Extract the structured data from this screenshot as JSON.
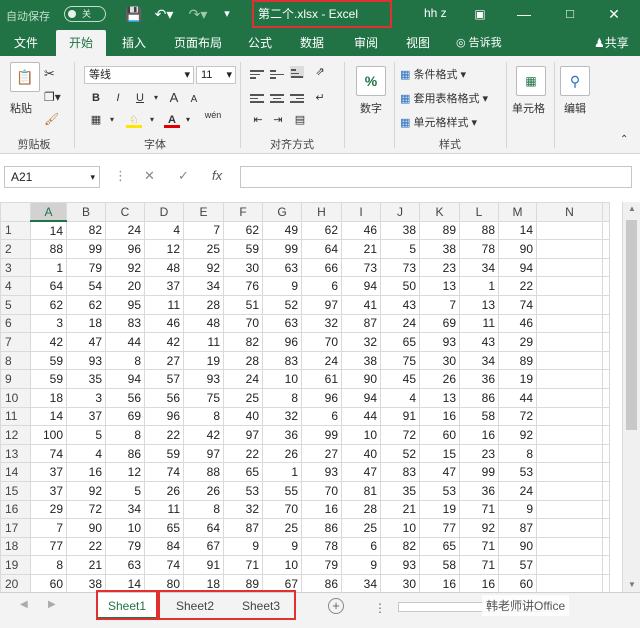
{
  "titlebar": {
    "autosave": "自动保存",
    "autosave_state": "关",
    "title": "第二个.xlsx  -  Excel",
    "user": "hh z"
  },
  "tabs": [
    "文件",
    "开始",
    "插入",
    "页面布局",
    "公式",
    "数据",
    "审阅",
    "视图"
  ],
  "active_tab": "开始",
  "tell_me": "告诉我",
  "share": "共享",
  "ribbon": {
    "clipboard": {
      "paste": "粘贴",
      "label": "剪贴板"
    },
    "font": {
      "name": "等线",
      "size": "11",
      "label": "字体",
      "bold": "B",
      "italic": "I",
      "underline": "U",
      "grow": "A",
      "shrink": "A",
      "wen": "wén"
    },
    "alignment": {
      "label": "对齐方式"
    },
    "number": {
      "label": "数字",
      "icon": "%"
    },
    "styles": {
      "conditional": "条件格式",
      "table": "套用表格格式",
      "cell": "单元格样式",
      "label": "样式"
    },
    "cells": {
      "label": "单元格"
    },
    "editing": {
      "label": "编辑"
    }
  },
  "formula_bar": {
    "name_box": "A21",
    "fx": "fx"
  },
  "columns": [
    "A",
    "B",
    "C",
    "D",
    "E",
    "F",
    "G",
    "H",
    "I",
    "J",
    "K",
    "L",
    "M",
    "N"
  ],
  "rows": [
    [
      14,
      82,
      24,
      4,
      7,
      62,
      49,
      62,
      46,
      38,
      89,
      88,
      14
    ],
    [
      88,
      99,
      96,
      12,
      25,
      59,
      99,
      64,
      21,
      5,
      38,
      78,
      90
    ],
    [
      1,
      79,
      92,
      48,
      92,
      30,
      63,
      66,
      73,
      73,
      23,
      34,
      94
    ],
    [
      64,
      54,
      20,
      37,
      34,
      76,
      9,
      6,
      94,
      50,
      13,
      1,
      22
    ],
    [
      62,
      62,
      95,
      11,
      28,
      51,
      52,
      97,
      41,
      43,
      7,
      13,
      74
    ],
    [
      3,
      18,
      83,
      46,
      48,
      70,
      63,
      32,
      87,
      24,
      69,
      11,
      46
    ],
    [
      42,
      47,
      44,
      42,
      11,
      82,
      96,
      70,
      32,
      65,
      93,
      43,
      29
    ],
    [
      59,
      93,
      8,
      27,
      19,
      28,
      83,
      24,
      38,
      75,
      30,
      34,
      89
    ],
    [
      59,
      35,
      94,
      57,
      93,
      24,
      10,
      61,
      90,
      45,
      26,
      36,
      19
    ],
    [
      18,
      3,
      56,
      56,
      75,
      25,
      8,
      96,
      94,
      4,
      13,
      86,
      44
    ],
    [
      14,
      37,
      69,
      96,
      8,
      40,
      32,
      6,
      44,
      91,
      16,
      58,
      72
    ],
    [
      100,
      5,
      8,
      22,
      42,
      97,
      36,
      99,
      10,
      72,
      60,
      16,
      92
    ],
    [
      74,
      4,
      86,
      59,
      97,
      22,
      26,
      27,
      40,
      52,
      15,
      23,
      8
    ],
    [
      37,
      16,
      12,
      74,
      88,
      65,
      1,
      93,
      47,
      83,
      47,
      99,
      53
    ],
    [
      37,
      92,
      5,
      26,
      26,
      53,
      55,
      70,
      81,
      35,
      53,
      36,
      24
    ],
    [
      29,
      72,
      34,
      11,
      8,
      32,
      70,
      16,
      28,
      21,
      19,
      71,
      9
    ],
    [
      7,
      90,
      10,
      65,
      64,
      87,
      25,
      86,
      25,
      10,
      77,
      92,
      87
    ],
    [
      77,
      22,
      79,
      84,
      67,
      9,
      9,
      78,
      6,
      82,
      65,
      71,
      90
    ],
    [
      8,
      21,
      63,
      74,
      91,
      71,
      10,
      79,
      9,
      93,
      58,
      71,
      57
    ],
    [
      60,
      38,
      14,
      80,
      18,
      89,
      67,
      86,
      34,
      30,
      16,
      16,
      60
    ]
  ],
  "sheets": [
    "Sheet1",
    "Sheet2",
    "Sheet3"
  ],
  "active_sheet": "Sheet1",
  "watermark": "韩老师讲Office",
  "colors": {
    "accent": "#217346",
    "highlight": "#e03030"
  }
}
